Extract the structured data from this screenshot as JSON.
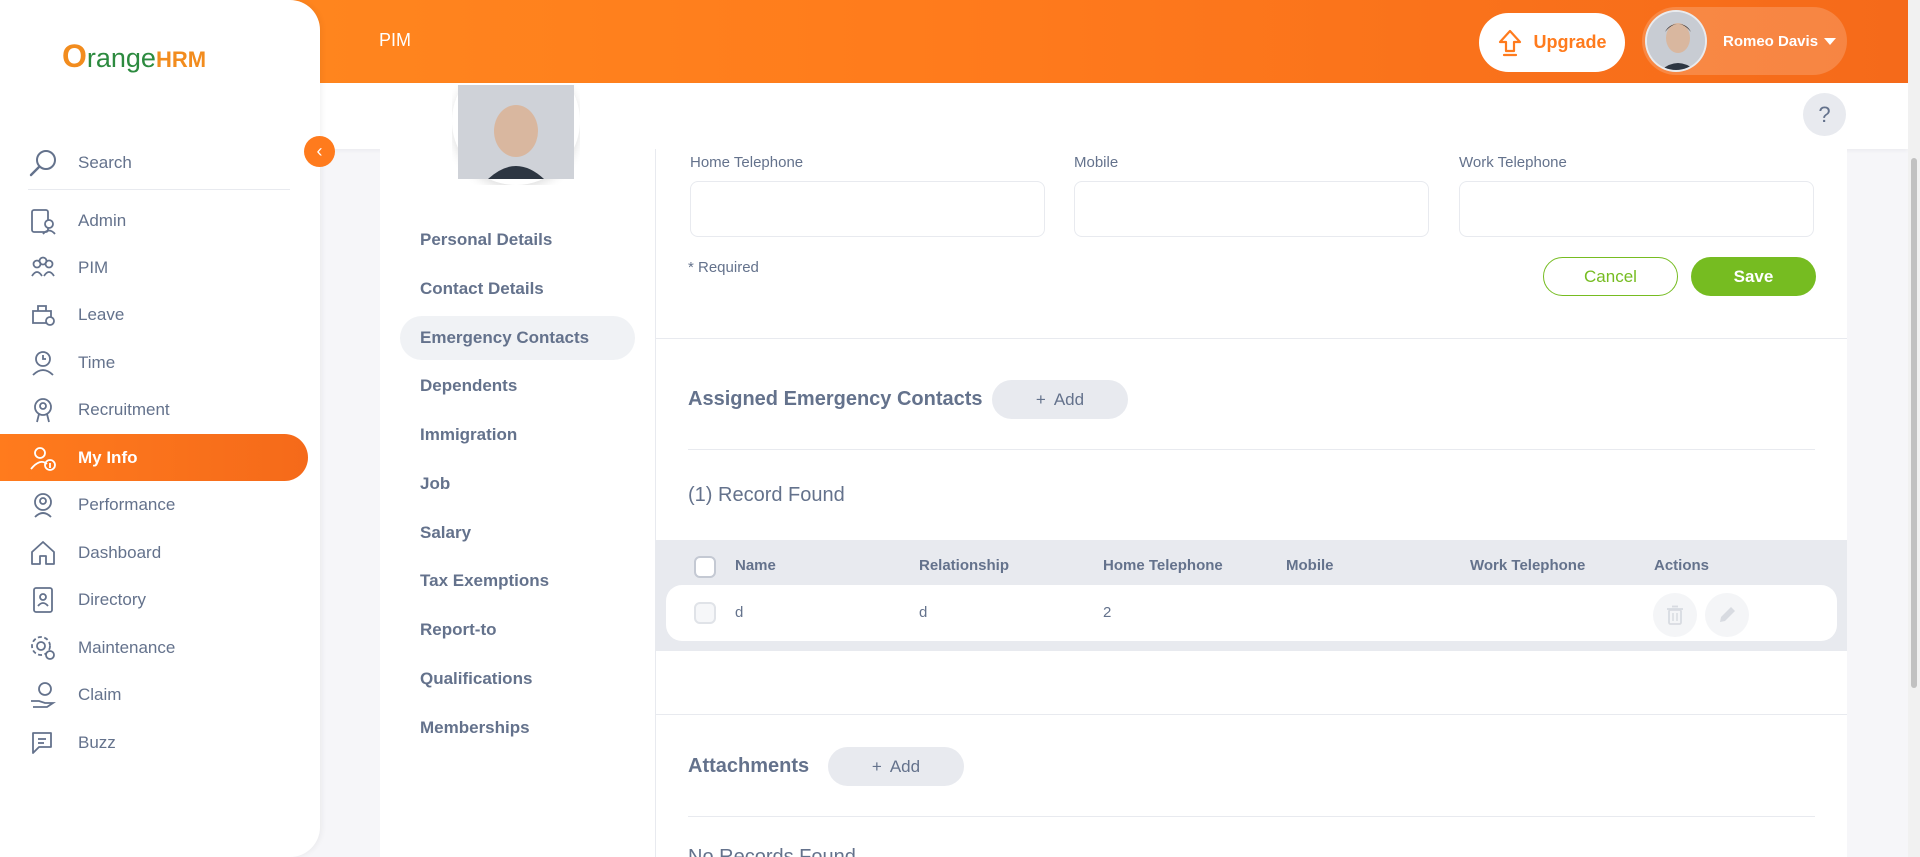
{
  "header": {
    "module": "PIM",
    "upgrade_label": "Upgrade",
    "user_name": "Romeo Davis",
    "help_label": "?"
  },
  "sidebar": {
    "logo_o": "O",
    "logo_range": "range",
    "logo_hrm": "HRM",
    "search_label": "Search",
    "collapse_icon": "‹",
    "items": [
      {
        "label": "Admin",
        "icon": "admin-icon"
      },
      {
        "label": "PIM",
        "icon": "pim-icon"
      },
      {
        "label": "Leave",
        "icon": "leave-icon"
      },
      {
        "label": "Time",
        "icon": "time-icon"
      },
      {
        "label": "Recruitment",
        "icon": "recruitment-icon"
      },
      {
        "label": "My Info",
        "icon": "my-info-icon",
        "active": true
      },
      {
        "label": "Performance",
        "icon": "performance-icon"
      },
      {
        "label": "Dashboard",
        "icon": "dashboard-icon"
      },
      {
        "label": "Directory",
        "icon": "directory-icon"
      },
      {
        "label": "Maintenance",
        "icon": "maintenance-icon"
      },
      {
        "label": "Claim",
        "icon": "claim-icon"
      },
      {
        "label": "Buzz",
        "icon": "buzz-icon"
      }
    ]
  },
  "tabs": [
    {
      "label": "Personal Details"
    },
    {
      "label": "Contact Details"
    },
    {
      "label": "Emergency Contacts",
      "active": true
    },
    {
      "label": "Dependents"
    },
    {
      "label": "Immigration"
    },
    {
      "label": "Job"
    },
    {
      "label": "Salary"
    },
    {
      "label": "Tax Exemptions"
    },
    {
      "label": "Report-to"
    },
    {
      "label": "Qualifications"
    },
    {
      "label": "Memberships"
    }
  ],
  "form": {
    "home_telephone_label": "Home Telephone",
    "home_telephone_value": "",
    "mobile_label": "Mobile",
    "mobile_value": "",
    "work_telephone_label": "Work Telephone",
    "work_telephone_value": "",
    "required_note": "* Required",
    "cancel_label": "Cancel",
    "save_label": "Save"
  },
  "contacts": {
    "title": "Assigned Emergency Contacts",
    "add_label": "Add",
    "records_found": "(1) Record Found",
    "columns": [
      "Name",
      "Relationship",
      "Home Telephone",
      "Mobile",
      "Work Telephone",
      "Actions"
    ],
    "rows": [
      {
        "name": "d",
        "relationship": "d",
        "home_telephone": "2",
        "mobile": "",
        "work_telephone": ""
      }
    ]
  },
  "attachments": {
    "title": "Attachments",
    "add_label": "Add",
    "no_records": "No Records Found"
  },
  "colors": {
    "brand_orange": "#ff7b1d",
    "save_green": "#76bc21"
  }
}
